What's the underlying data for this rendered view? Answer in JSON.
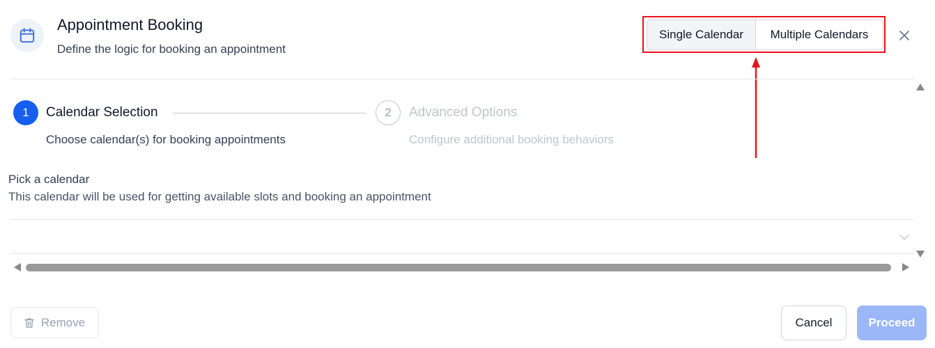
{
  "header": {
    "icon": "calendar-icon",
    "title": "Appointment Booking",
    "subtitle": "Define the logic for booking an appointment",
    "toggle": {
      "single_label": "Single Calendar",
      "multiple_label": "Multiple Calendars",
      "selected": "Single Calendar"
    },
    "close_icon": "close-icon"
  },
  "annotation": {
    "highlight_color": "#e8131b"
  },
  "steps": [
    {
      "number": "1",
      "title": "Calendar Selection",
      "description": "Choose calendar(s) for booking appointments",
      "state": "active"
    },
    {
      "number": "2",
      "title": "Advanced Options",
      "description": "Configure additional booking behaviors",
      "state": "inactive"
    }
  ],
  "form": {
    "pick_label": "Pick a calendar",
    "pick_help": "This calendar will be used for getting available slots and booking an appointment",
    "select_value": ""
  },
  "footer": {
    "remove_label": "Remove",
    "cancel_label": "Cancel",
    "proceed_label": "Proceed"
  },
  "colors": {
    "accent": "#155eef",
    "proceed_disabled": "#9bb7f7"
  }
}
